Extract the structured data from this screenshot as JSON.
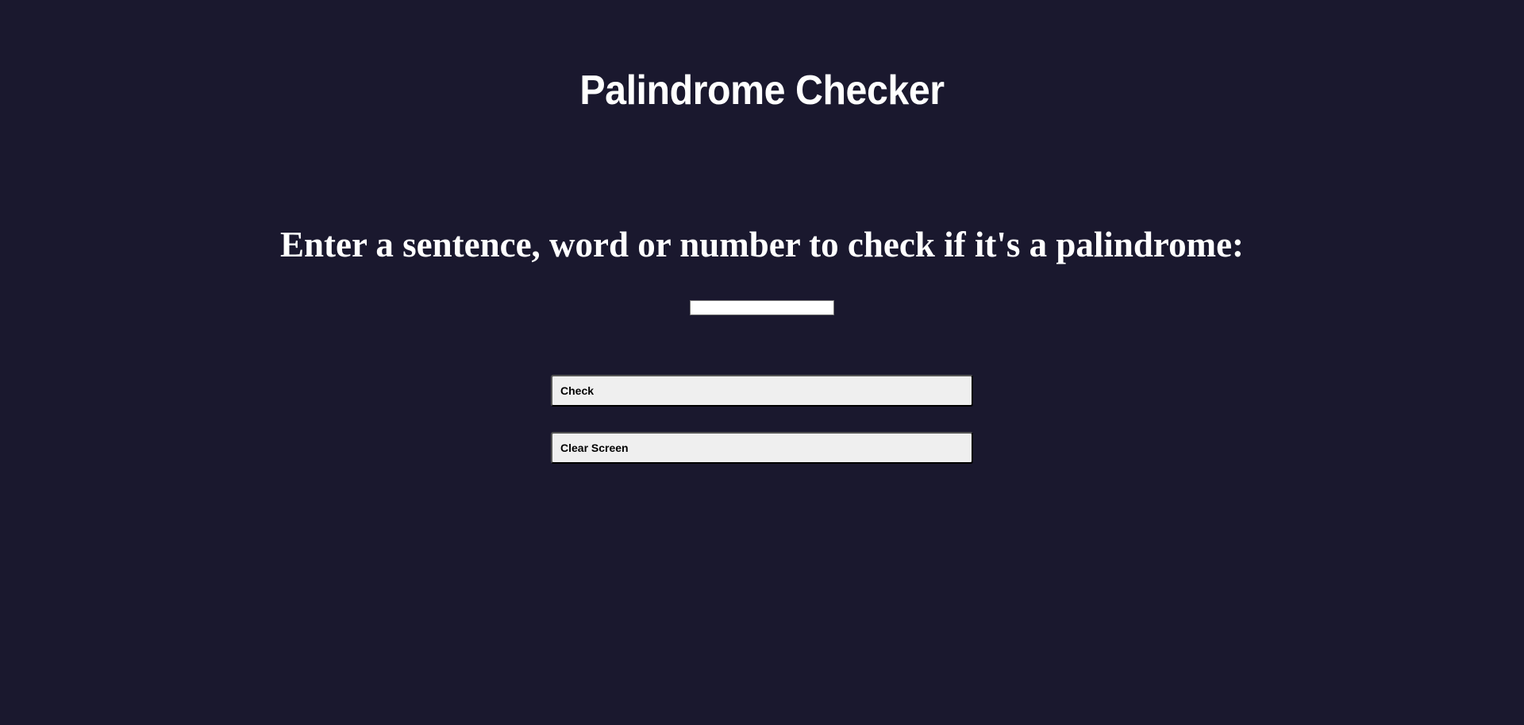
{
  "header": {
    "title": "Palindrome Checker"
  },
  "main": {
    "prompt": "Enter a sentence, word or number to check if it's a palindrome:",
    "input": {
      "value": "",
      "placeholder": ""
    },
    "check_label": "Check",
    "clear_label": "Clear Screen"
  },
  "colors": {
    "background": "#1a182e",
    "text": "#ffffff",
    "button": "#efefef"
  }
}
